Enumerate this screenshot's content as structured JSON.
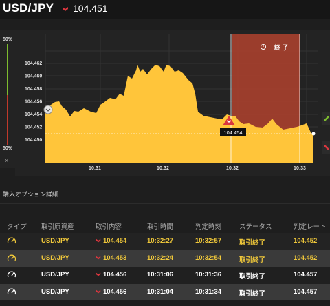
{
  "header": {
    "pair": "USD/JPY",
    "price": "104.451",
    "direction_icon": "down-arrow-icon",
    "direction_color": "#d9363e"
  },
  "gauge": {
    "top_label": "50%",
    "bottom_label": "50%",
    "close_label": "×"
  },
  "chart_data": {
    "type": "area",
    "color": "#ffc53a",
    "y_ticks": [
      "104.462",
      "104.460",
      "104.458",
      "104.456",
      "104.454",
      "104.452",
      "104.450"
    ],
    "x_ticks": [
      "10:31",
      "10:32",
      "10:32",
      "10:33"
    ],
    "current_price_label": "104.451",
    "entry_marker": {
      "label": "104.454",
      "icon": "down-arrow-icon"
    },
    "expiry_zone": {
      "label": "終 了",
      "icon": "clock-icon",
      "color": "#a8402d"
    }
  },
  "section": {
    "title": "購入オプション詳細"
  },
  "table": {
    "headers": [
      "タイプ",
      "取引原資産",
      "取引内容",
      "取引時間",
      "判定時刻",
      "ステータス",
      "判定レート"
    ],
    "rows": [
      {
        "icon": "speedometer-icon",
        "asset": "USD/JPY",
        "content": "104.454",
        "time": "10:32:27",
        "judge_time": "10:32:57",
        "status": "取引終了",
        "rate": "104.452",
        "style": "active"
      },
      {
        "icon": "speedometer-icon",
        "asset": "USD/JPY",
        "content": "104.453",
        "time": "10:32:24",
        "judge_time": "10:32:54",
        "status": "取引終了",
        "rate": "104.452",
        "style": "active"
      },
      {
        "icon": "speedometer-icon",
        "asset": "USD/JPY",
        "content": "104.456",
        "time": "10:31:06",
        "judge_time": "10:31:36",
        "status": "取引終了",
        "rate": "104.457",
        "style": "done"
      },
      {
        "icon": "speedometer-icon",
        "asset": "USD/JPY",
        "content": "104.456",
        "time": "10:31:04",
        "judge_time": "10:31:34",
        "status": "取引終了",
        "rate": "104.457",
        "style": "done"
      }
    ]
  }
}
